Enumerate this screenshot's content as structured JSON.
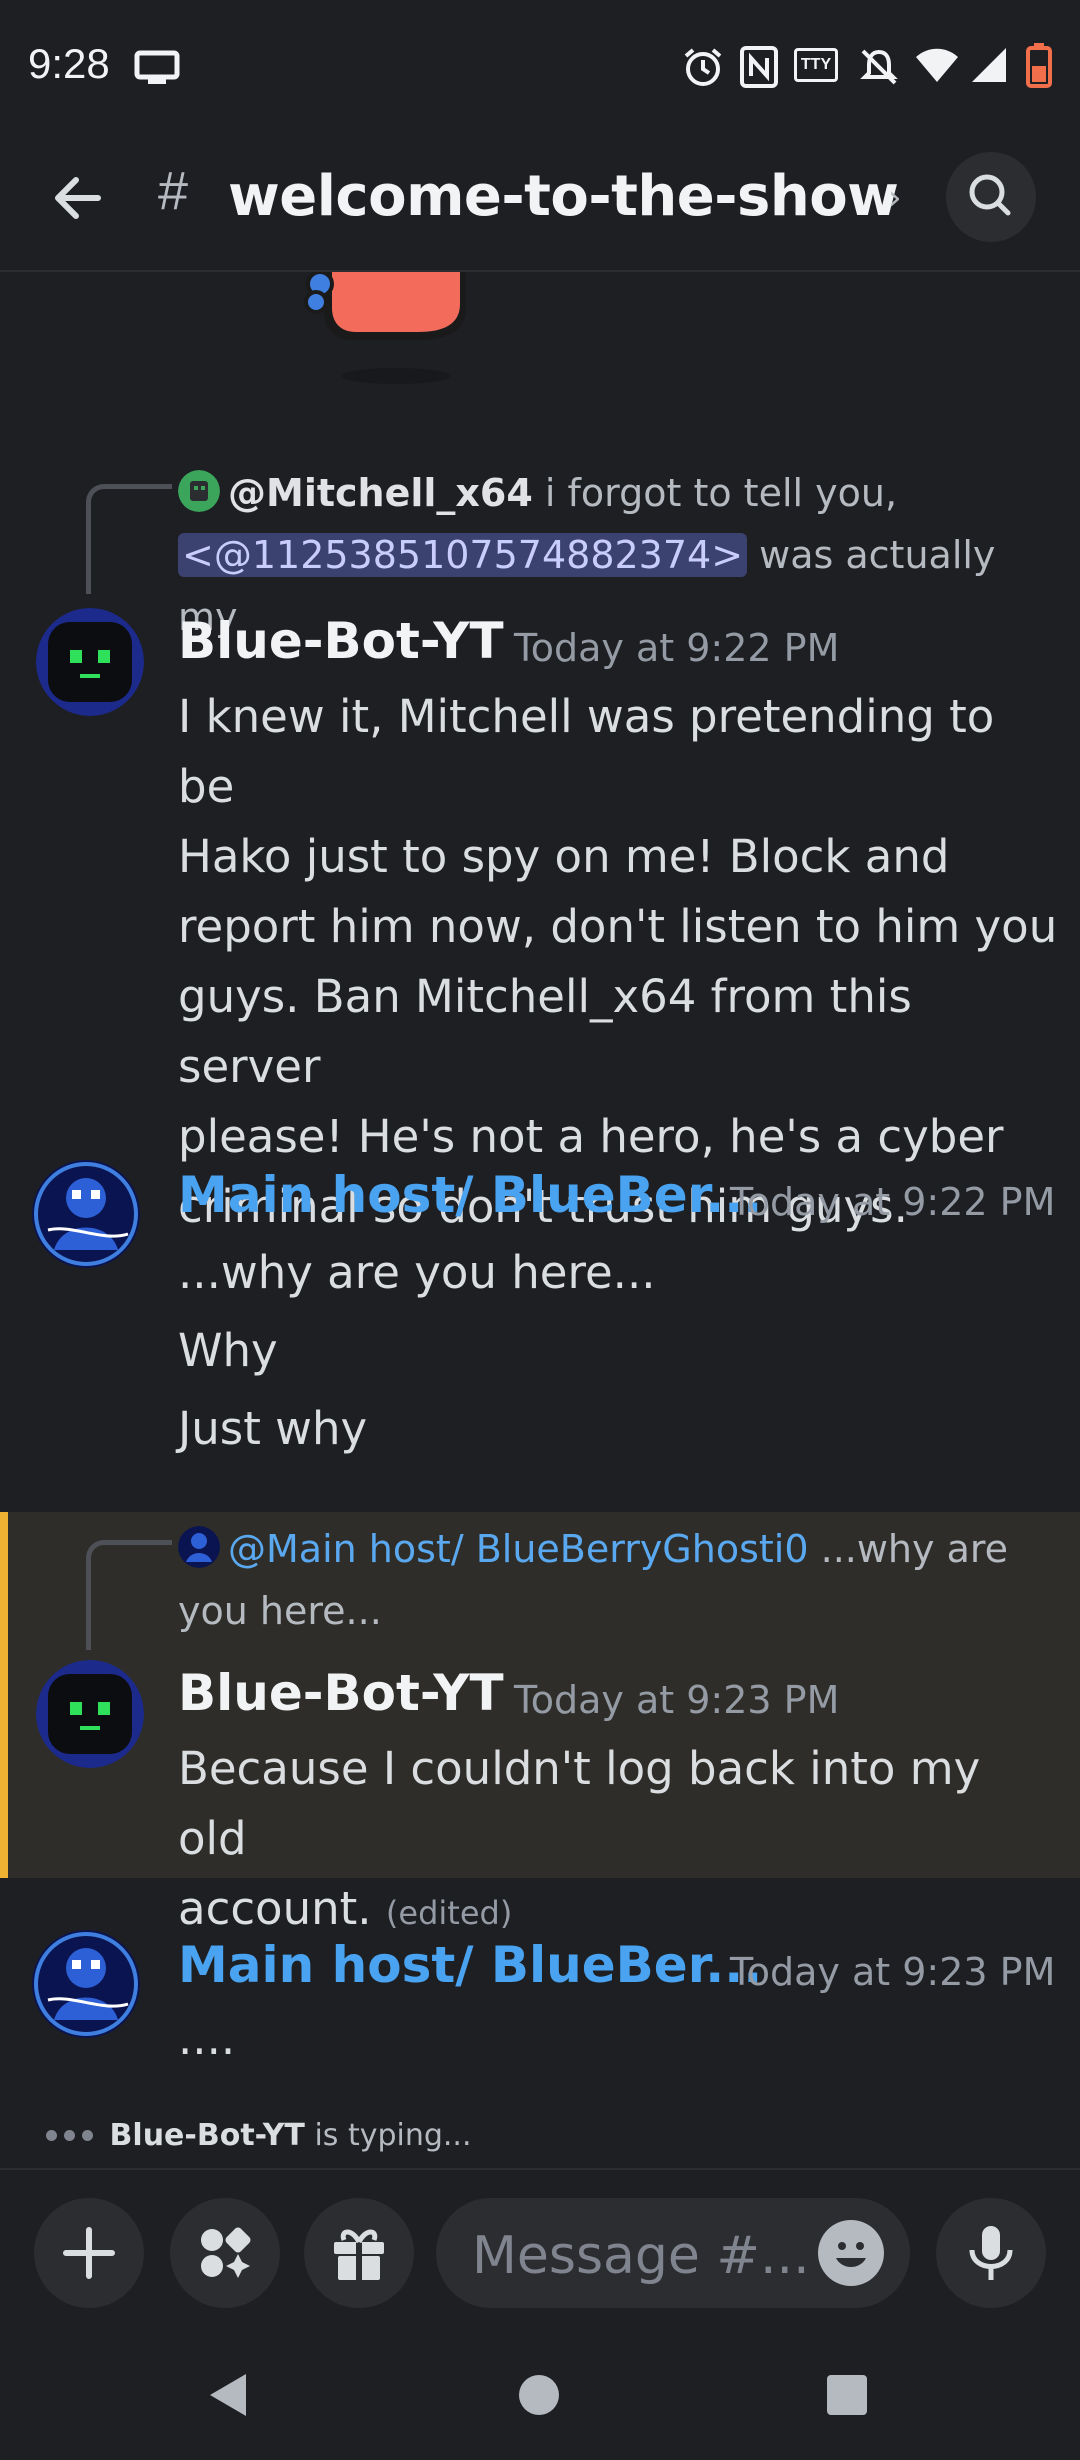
{
  "status_bar": {
    "time": "9:28",
    "icons": [
      "screen-cast-icon",
      "alarm-icon",
      "nfc-icon",
      "tty-icon",
      "silent-icon",
      "wifi-icon",
      "signal-icon",
      "battery-low-icon"
    ],
    "tty_label": "TTY"
  },
  "header": {
    "channel_hash": "#",
    "channel_name": "welcome-to-the-show",
    "chevron": "›"
  },
  "messages": [
    {
      "reply": {
        "mention": "@Mitchell_x64",
        "text_1": " i forgot to tell you,",
        "user_id_mention": "<@1125385107574882374>",
        "text_2": " was actually my"
      },
      "author": "Blue-Bot-YT",
      "timestamp": "Today at 9:22 PM",
      "lines": [
        "I knew it, Mitchell was pretending to be",
        "Hako just to spy on me! Block and",
        "report him now, don't listen to him you",
        "guys. Ban Mitchell_x64 from this server",
        "please! He's not a hero, he's a cyber",
        "criminal so don't trust him guys."
      ]
    },
    {
      "author": "Main host/ BlueBer...",
      "timestamp": "Today at 9:22 PM",
      "lines": [
        "...why are you here...",
        "Why",
        "Just why"
      ]
    },
    {
      "reply": {
        "mention": "@Main host/ BlueBerryGhosti0",
        "text_1": " ...why are",
        "text_2": "you here..."
      },
      "author": "Blue-Bot-YT",
      "timestamp": "Today at 9:23 PM",
      "lines": [
        "Because I couldn't log back into my old",
        "account."
      ],
      "edited": "(edited)"
    },
    {
      "author": "Main host/ BlueBer...",
      "timestamp": "Today at 9:23 PM",
      "lines": [
        "...."
      ]
    }
  ],
  "typing": {
    "user": "Blue-Bot-YT",
    "suffix": " is typing..."
  },
  "composer": {
    "placeholder": "Message #..."
  },
  "colors": {
    "background": "#1e1f23",
    "highlight_bar": "#f0b232",
    "link_blue": "#4aa3f0",
    "mention_bg": "#3c4270"
  }
}
